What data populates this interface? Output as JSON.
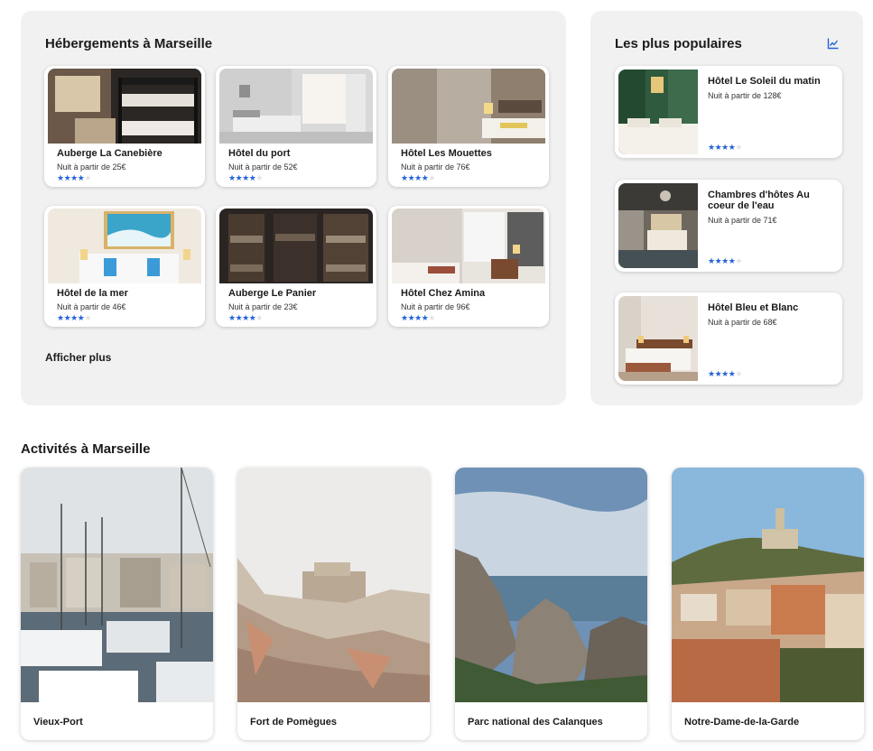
{
  "hebergements": {
    "title": "Hébergements à Marseille",
    "show_more": "Afficher plus",
    "hotels": [
      {
        "name": "Auberge La Canebière",
        "price": "Nuit à partir de 25€",
        "stars": 4,
        "max_stars": 5,
        "photo": "bunk-beds-photo"
      },
      {
        "name": "Hôtel du port",
        "price": "Nuit à partir de 52€",
        "stars": 4,
        "max_stars": 5,
        "photo": "white-room-photo"
      },
      {
        "name": "Hôtel Les Mouettes",
        "price": "Nuit à partir de 76€",
        "stars": 4,
        "max_stars": 5,
        "photo": "modern-room-photo"
      },
      {
        "name": "Hôtel de la mer",
        "price": "Nuit à partir de 46€",
        "stars": 4,
        "max_stars": 5,
        "photo": "seaside-room-photo"
      },
      {
        "name": "Auberge Le Panier",
        "price": "Nuit à partir de 23€",
        "stars": 4,
        "max_stars": 5,
        "photo": "dorm-photo"
      },
      {
        "name": "Hôtel Chez Amina",
        "price": "Nuit à partir de 96€",
        "stars": 4,
        "max_stars": 5,
        "photo": "bright-room-photo"
      }
    ]
  },
  "populaires": {
    "title": "Les plus populaires",
    "icon": "trending-chart-icon",
    "hotels": [
      {
        "name": "Hôtel Le Soleil du matin",
        "price": "Nuit à partir de 128€",
        "stars": 4,
        "max_stars": 5,
        "photo": "green-room-photo"
      },
      {
        "name": "Chambres d'hôtes Au coeur de l'eau",
        "price": "Nuit à partir de 71€",
        "stars": 4,
        "max_stars": 5,
        "photo": "chandelier-room-photo"
      },
      {
        "name": "Hôtel Bleu et Blanc",
        "price": "Nuit à partir de 68€",
        "stars": 4,
        "max_stars": 5,
        "photo": "warm-room-photo"
      }
    ]
  },
  "activites": {
    "title": "Activités à Marseille",
    "items": [
      {
        "name": "Vieux-Port",
        "photo": "harbor-boats-photo"
      },
      {
        "name": "Fort de Pomègues",
        "photo": "rocky-fort-photo"
      },
      {
        "name": "Parc national des Calanques",
        "photo": "calanques-cliffs-photo"
      },
      {
        "name": "Notre-Dame-de-la-Garde",
        "photo": "basilica-hill-photo"
      }
    ]
  },
  "colors": {
    "panel_bg": "#f1f1f1",
    "star_active": "#2563d8",
    "star_inactive": "#e2e2e2",
    "accent": "#2563d8"
  }
}
